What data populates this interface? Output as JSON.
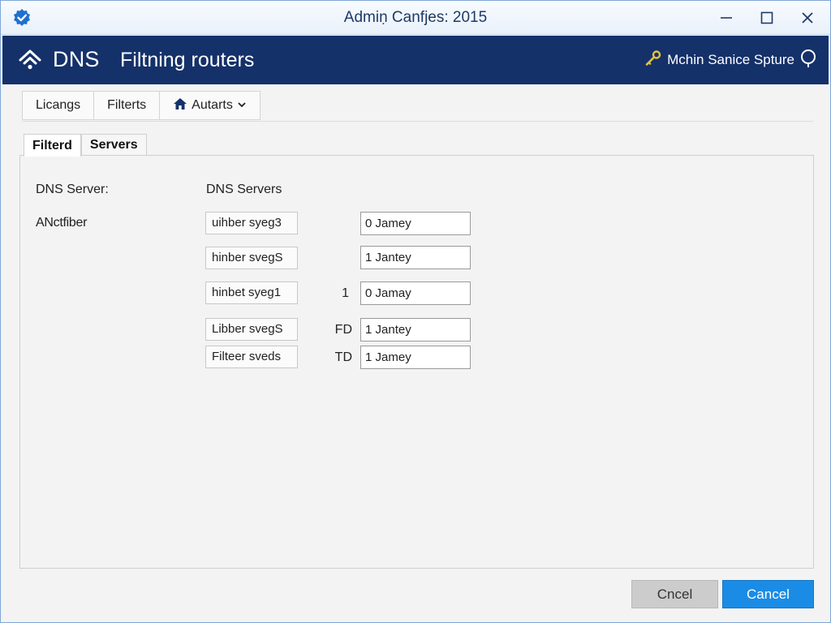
{
  "window": {
    "title": "Admiṇ Canfjes: 2015"
  },
  "header": {
    "app_name": "DNS",
    "subtitle": "Filtning routers",
    "right_label": "Mchin Sanice Spture",
    "bg_color": "#15316a"
  },
  "toolbar": {
    "items": [
      "Licangs",
      "Filterts",
      "Autarts"
    ]
  },
  "tabs": [
    {
      "label": "Filterd",
      "active": true
    },
    {
      "label": "Servers",
      "active": false
    }
  ],
  "form": {
    "left_label": "DNS Server:",
    "column_header": "DNS Servers",
    "row_label": "ANctfiber",
    "rows": [
      {
        "name": "uihber syeg3",
        "mid": "",
        "value": "0 Jamey"
      },
      {
        "name": "hinber svegS",
        "mid": "",
        "value": "1 Jantey"
      },
      {
        "name": "hinbet syeg1",
        "mid": "1",
        "value": "0 Jamay"
      },
      {
        "name": "Libber svegS",
        "mid": "FD",
        "value": "1 Jantey"
      },
      {
        "name": "Filteer sveds",
        "mid": "TD",
        "value": "1 Jamey"
      }
    ]
  },
  "footer": {
    "secondary_label": "Cncel",
    "primary_label": "Cancel",
    "primary_color": "#1a8ce6"
  },
  "icons": {
    "app": "shield-check-icon",
    "dns": "wifi-arrow-icon",
    "key": "key-icon",
    "help": "help-bubble-icon",
    "home": "home-icon",
    "dropdown": "chevron-down-icon"
  }
}
